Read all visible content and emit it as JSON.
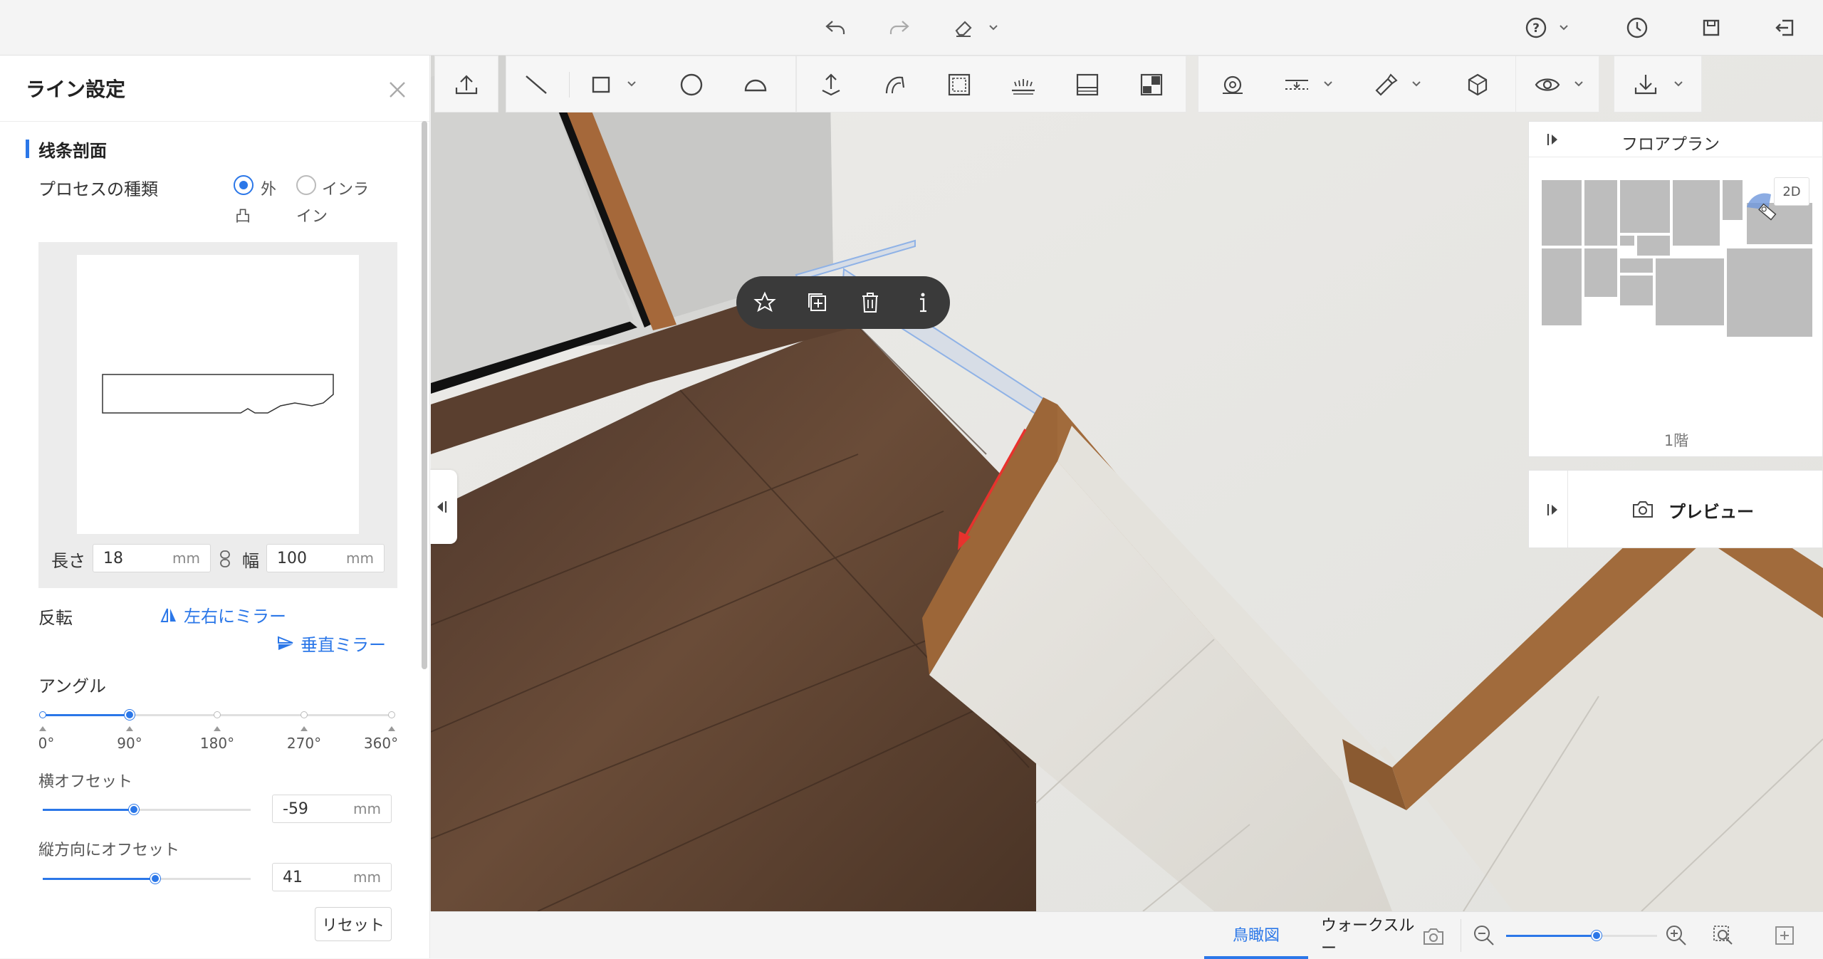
{
  "topbar": {
    "icons": [
      "undo-icon",
      "redo-icon",
      "eraser-icon",
      "help-icon",
      "history-icon",
      "save-icon",
      "exit-icon"
    ]
  },
  "panel": {
    "title": "ライン設定",
    "section_title": "线条剖面",
    "process_type_label": "プロセスの種類",
    "option_outer_line1": "外",
    "option_outer_line2": "凸",
    "option_inline_line1": "インラ",
    "option_inline_line2": "イン",
    "length_label": "長さ",
    "length_value": "18",
    "length_unit": "mm",
    "width_label": "幅",
    "width_value": "100",
    "width_unit": "mm",
    "flip_label": "反転",
    "mirror_lr": "左右にミラー",
    "mirror_vertical": "垂直ミラー",
    "angle_label": "アングル",
    "angle_ticks": [
      "0°",
      "90°",
      "180°",
      "270°",
      "360°"
    ],
    "angle_value": 90,
    "h_offset_label": "横オフセット",
    "h_offset_value": "-59",
    "h_offset_unit": "mm",
    "v_offset_label": "縦方向にオフセット",
    "v_offset_value": "41",
    "v_offset_unit": "mm",
    "reset_label": "リセット"
  },
  "floorplan": {
    "title": "フロアプラン",
    "view_toggle": "2D",
    "level": "1階"
  },
  "preview": {
    "label": "プレビュー"
  },
  "bottombar": {
    "tab_birdseye": "鳥瞰図",
    "tab_walkthrough": "ウォークスルー"
  },
  "colors": {
    "accent": "#2b77e8",
    "floor": "#5b4030",
    "baseboard": "#9c6638",
    "arrow": "#e8322d"
  }
}
